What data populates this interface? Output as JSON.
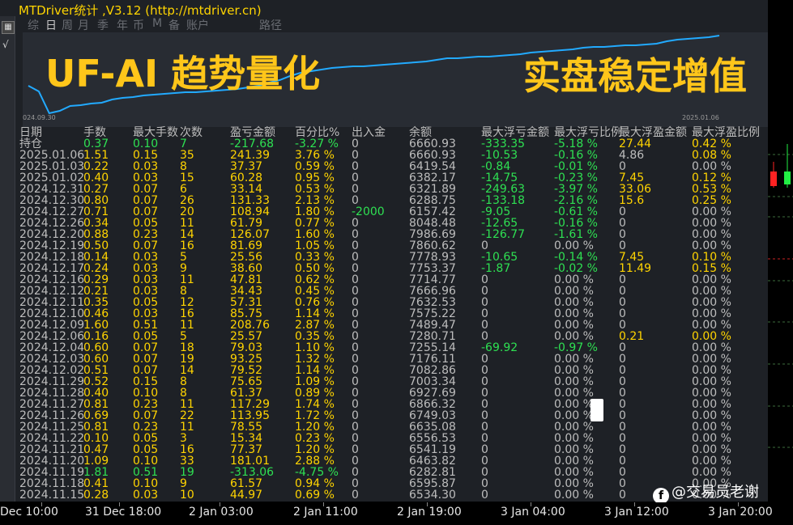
{
  "window": {
    "title": "MTDriver统计 ,V3.12 (http://mtdriver.cn)"
  },
  "sidebar": {
    "buttons": [
      {
        "name": "grid-icon",
        "glyph": "▦"
      },
      {
        "name": "close-icon",
        "glyph": "☒"
      },
      {
        "name": "sqrt-icon",
        "glyph": "√"
      }
    ]
  },
  "tabs": [
    {
      "label": "综",
      "active": false
    },
    {
      "label": "日",
      "active": true
    },
    {
      "label": "周",
      "active": false
    },
    {
      "label": "月",
      "active": false
    },
    {
      "label": "季",
      "active": false
    },
    {
      "label": "年",
      "active": false
    },
    {
      "label": "币",
      "active": false
    },
    {
      "label": "M",
      "active": false
    },
    {
      "label": "备",
      "active": false
    },
    {
      "label": "账户",
      "active": false
    },
    {
      "label": "路径",
      "active": false
    }
  ],
  "equity": {
    "overlay_left": "UF-AI 趋势量化",
    "overlay_right": "实盘稳定增值",
    "date_start": "024.09.30",
    "date_end": "2025.01.06",
    "values": [
      38,
      31,
      4,
      7,
      13,
      14,
      16,
      17,
      21,
      23,
      24,
      26,
      27,
      28,
      29,
      30,
      30,
      31,
      32,
      33,
      34,
      36,
      38,
      42,
      45,
      50,
      54,
      56,
      58,
      60,
      61,
      62,
      62,
      63,
      64,
      65,
      66,
      67,
      68,
      70,
      72,
      72,
      73,
      74,
      74,
      75,
      76,
      77,
      79,
      80,
      81,
      82,
      83,
      85,
      86,
      86,
      87,
      88,
      88,
      89,
      90,
      93,
      95,
      96,
      97,
      98,
      100
    ]
  },
  "table": {
    "headers": [
      "日期",
      "手数",
      "最大手数",
      "次数",
      "盈亏金额",
      "百分比%",
      "出入金",
      "余额",
      "最大浮亏金额",
      "最大浮亏比例",
      "最大浮盈金额",
      "最大浮盈比例"
    ],
    "rows": [
      {
        "c": [
          "持仓",
          "0.37",
          "0.10",
          "7",
          "-217.68",
          "-3.27 %",
          "0",
          "6660.93",
          "-333.35",
          "-5.18 %",
          "27.44",
          "0.42 %"
        ],
        "k": [
          "w",
          "g",
          "g",
          "g",
          "g",
          "g",
          "w",
          "w",
          "g",
          "g",
          "y",
          "y"
        ]
      },
      {
        "c": [
          "2025.01.06",
          "1.51",
          "0.15",
          "35",
          "241.39",
          "3.76 %",
          "0",
          "6660.93",
          "-10.53",
          "-0.16 %",
          "4.86",
          "0.08 %"
        ],
        "k": [
          "w",
          "y",
          "y",
          "y",
          "y",
          "y",
          "w",
          "w",
          "g",
          "g",
          "w",
          "y"
        ]
      },
      {
        "c": [
          "2025.01.03",
          "0.22",
          "0.03",
          "8",
          "37.37",
          "0.59 %",
          "0",
          "6419.54",
          "-0.84",
          "-0.01 %",
          "0",
          "0.00 %"
        ],
        "k": [
          "w",
          "y",
          "y",
          "y",
          "y",
          "y",
          "w",
          "w",
          "g",
          "g",
          "w",
          "w"
        ]
      },
      {
        "c": [
          "2025.01.02",
          "0.40",
          "0.03",
          "15",
          "60.28",
          "0.95 %",
          "0",
          "6382.17",
          "-14.75",
          "-0.23 %",
          "7.45",
          "0.12 %"
        ],
        "k": [
          "w",
          "y",
          "y",
          "y",
          "y",
          "y",
          "w",
          "w",
          "g",
          "g",
          "y",
          "y"
        ]
      },
      {
        "c": [
          "2024.12.31",
          "0.27",
          "0.07",
          "6",
          "33.14",
          "0.53 %",
          "0",
          "6321.89",
          "-249.63",
          "-3.97 %",
          "33.06",
          "0.53 %"
        ],
        "k": [
          "w",
          "y",
          "y",
          "y",
          "y",
          "y",
          "w",
          "w",
          "g",
          "g",
          "y",
          "y"
        ]
      },
      {
        "c": [
          "2024.12.30",
          "0.80",
          "0.07",
          "26",
          "131.33",
          "2.13 %",
          "0",
          "6288.75",
          "-133.18",
          "-2.16 %",
          "15.6",
          "0.25 %"
        ],
        "k": [
          "w",
          "y",
          "y",
          "y",
          "y",
          "y",
          "w",
          "w",
          "g",
          "g",
          "y",
          "y"
        ]
      },
      {
        "c": [
          "2024.12.27",
          "0.71",
          "0.07",
          "20",
          "108.94",
          "1.80 %",
          "-2000",
          "6157.42",
          "-9.05",
          "-0.61 %",
          "0",
          "0.00 %"
        ],
        "k": [
          "w",
          "y",
          "y",
          "y",
          "y",
          "y",
          "g",
          "w",
          "g",
          "g",
          "w",
          "w"
        ]
      },
      {
        "c": [
          "2024.12.26",
          "0.34",
          "0.05",
          "11",
          "61.79",
          "0.77 %",
          "0",
          "8048.48",
          "-12.65",
          "-0.16 %",
          "0",
          "0.00 %"
        ],
        "k": [
          "w",
          "y",
          "y",
          "y",
          "y",
          "y",
          "w",
          "w",
          "g",
          "g",
          "w",
          "w"
        ]
      },
      {
        "c": [
          "2024.12.20",
          "0.88",
          "0.23",
          "14",
          "126.07",
          "1.60 %",
          "0",
          "7986.69",
          "-126.77",
          "-1.61 %",
          "0",
          "0.00 %"
        ],
        "k": [
          "w",
          "y",
          "y",
          "y",
          "y",
          "y",
          "w",
          "w",
          "g",
          "g",
          "w",
          "w"
        ]
      },
      {
        "c": [
          "2024.12.19",
          "0.50",
          "0.07",
          "16",
          "81.69",
          "1.05 %",
          "0",
          "7860.62",
          "0",
          "0.00 %",
          "0",
          "0.00 %"
        ],
        "k": [
          "w",
          "y",
          "y",
          "y",
          "y",
          "y",
          "w",
          "w",
          "w",
          "w",
          "w",
          "w"
        ]
      },
      {
        "c": [
          "2024.12.18",
          "0.14",
          "0.03",
          "5",
          "25.56",
          "0.33 %",
          "0",
          "7778.93",
          "-10.65",
          "-0.14 %",
          "7.45",
          "0.10 %"
        ],
        "k": [
          "w",
          "y",
          "y",
          "y",
          "y",
          "y",
          "w",
          "w",
          "g",
          "g",
          "y",
          "y"
        ]
      },
      {
        "c": [
          "2024.12.17",
          "0.24",
          "0.03",
          "9",
          "38.60",
          "0.50 %",
          "0",
          "7753.37",
          "-1.87",
          "-0.02 %",
          "11.49",
          "0.15 %"
        ],
        "k": [
          "w",
          "y",
          "y",
          "y",
          "y",
          "y",
          "w",
          "w",
          "g",
          "g",
          "y",
          "y"
        ]
      },
      {
        "c": [
          "2024.12.16",
          "0.29",
          "0.03",
          "11",
          "47.81",
          "0.62 %",
          "0",
          "7714.77",
          "0",
          "0.00 %",
          "0",
          "0.00 %"
        ],
        "k": [
          "w",
          "y",
          "y",
          "y",
          "y",
          "y",
          "w",
          "w",
          "w",
          "w",
          "w",
          "w"
        ]
      },
      {
        "c": [
          "2024.12.12",
          "0.21",
          "0.03",
          "8",
          "34.43",
          "0.45 %",
          "0",
          "7666.96",
          "0",
          "0.00 %",
          "0",
          "0.00 %"
        ],
        "k": [
          "w",
          "y",
          "y",
          "y",
          "y",
          "y",
          "w",
          "w",
          "w",
          "w",
          "w",
          "w"
        ]
      },
      {
        "c": [
          "2024.12.11",
          "0.35",
          "0.05",
          "12",
          "57.31",
          "0.76 %",
          "0",
          "7632.53",
          "0",
          "0.00 %",
          "0",
          "0.00 %"
        ],
        "k": [
          "w",
          "y",
          "y",
          "y",
          "y",
          "y",
          "w",
          "w",
          "w",
          "w",
          "w",
          "w"
        ]
      },
      {
        "c": [
          "2024.12.10",
          "0.46",
          "0.03",
          "16",
          "85.75",
          "1.14 %",
          "0",
          "7575.22",
          "0",
          "0.00 %",
          "0",
          "0.00 %"
        ],
        "k": [
          "w",
          "y",
          "y",
          "y",
          "y",
          "y",
          "w",
          "w",
          "w",
          "w",
          "w",
          "w"
        ]
      },
      {
        "c": [
          "2024.12.09",
          "1.60",
          "0.51",
          "11",
          "208.76",
          "2.87 %",
          "0",
          "7489.47",
          "0",
          "0.00 %",
          "0",
          "0.00 %"
        ],
        "k": [
          "w",
          "y",
          "y",
          "y",
          "y",
          "y",
          "w",
          "w",
          "w",
          "w",
          "w",
          "w"
        ]
      },
      {
        "c": [
          "2024.12.06",
          "0.16",
          "0.05",
          "5",
          "25.57",
          "0.35 %",
          "0",
          "7280.71",
          "0",
          "0.00 %",
          "0.21",
          "0.00 %"
        ],
        "k": [
          "w",
          "y",
          "y",
          "y",
          "y",
          "y",
          "w",
          "w",
          "w",
          "w",
          "y",
          "y"
        ]
      },
      {
        "c": [
          "2024.12.04",
          "0.60",
          "0.07",
          "18",
          "79.03",
          "1.10 %",
          "0",
          "7255.14",
          "-69.92",
          "-0.97 %",
          "0",
          "0.00 %"
        ],
        "k": [
          "w",
          "y",
          "y",
          "y",
          "y",
          "y",
          "w",
          "w",
          "g",
          "g",
          "w",
          "w"
        ]
      },
      {
        "c": [
          "2024.12.03",
          "0.60",
          "0.07",
          "19",
          "93.25",
          "1.32 %",
          "0",
          "7176.11",
          "0",
          "0.00 %",
          "0",
          "0.00 %"
        ],
        "k": [
          "w",
          "y",
          "y",
          "y",
          "y",
          "y",
          "w",
          "w",
          "w",
          "w",
          "w",
          "w"
        ]
      },
      {
        "c": [
          "2024.12.02",
          "0.51",
          "0.07",
          "14",
          "79.52",
          "1.14 %",
          "0",
          "7082.86",
          "0",
          "0.00 %",
          "0",
          "0.00 %"
        ],
        "k": [
          "w",
          "y",
          "y",
          "y",
          "y",
          "y",
          "w",
          "w",
          "w",
          "w",
          "w",
          "w"
        ]
      },
      {
        "c": [
          "2024.11.29",
          "0.52",
          "0.15",
          "8",
          "75.65",
          "1.09 %",
          "0",
          "7003.34",
          "0",
          "0.00 %",
          "0",
          "0.00 %"
        ],
        "k": [
          "w",
          "y",
          "y",
          "y",
          "y",
          "y",
          "w",
          "w",
          "w",
          "w",
          "w",
          "w"
        ]
      },
      {
        "c": [
          "2024.11.28",
          "0.40",
          "0.10",
          "8",
          "61.37",
          "0.89 %",
          "0",
          "6927.69",
          "0",
          "0.00 %",
          "0",
          "0.00 %"
        ],
        "k": [
          "w",
          "y",
          "y",
          "y",
          "y",
          "y",
          "w",
          "w",
          "w",
          "w",
          "w",
          "w"
        ]
      },
      {
        "c": [
          "2024.11.27",
          "0.81",
          "0.23",
          "11",
          "117.29",
          "1.74 %",
          "0",
          "6866.32",
          "0",
          "0.00 %",
          "0",
          "0.00 %"
        ],
        "k": [
          "w",
          "y",
          "y",
          "y",
          "y",
          "y",
          "w",
          "w",
          "w",
          "w",
          "w",
          "w"
        ]
      },
      {
        "c": [
          "2024.11.26",
          "0.69",
          "0.07",
          "22",
          "113.95",
          "1.72 %",
          "0",
          "6749.03",
          "0",
          "0.00 %",
          "0",
          "0.00 %"
        ],
        "k": [
          "w",
          "y",
          "y",
          "y",
          "y",
          "y",
          "w",
          "w",
          "w",
          "w",
          "w",
          "w"
        ]
      },
      {
        "c": [
          "2024.11.25",
          "0.81",
          "0.23",
          "11",
          "78.55",
          "1.20 %",
          "0",
          "6635.08",
          "0",
          "0.00 %",
          "0",
          "0.00 %"
        ],
        "k": [
          "w",
          "y",
          "y",
          "y",
          "y",
          "y",
          "w",
          "w",
          "w",
          "w",
          "w",
          "w"
        ]
      },
      {
        "c": [
          "2024.11.22",
          "0.10",
          "0.05",
          "3",
          "15.34",
          "0.23 %",
          "0",
          "6556.53",
          "0",
          "0.00 %",
          "0",
          "0.00 %"
        ],
        "k": [
          "w",
          "y",
          "y",
          "y",
          "y",
          "y",
          "w",
          "w",
          "w",
          "w",
          "w",
          "w"
        ]
      },
      {
        "c": [
          "2024.11.21",
          "0.47",
          "0.05",
          "16",
          "77.37",
          "1.20 %",
          "0",
          "6541.19",
          "0",
          "0.00 %",
          "0",
          "0.00 %"
        ],
        "k": [
          "w",
          "y",
          "y",
          "y",
          "y",
          "y",
          "w",
          "w",
          "w",
          "w",
          "w",
          "w"
        ]
      },
      {
        "c": [
          "2024.11.20",
          "1.09",
          "0.10",
          "33",
          "181.01",
          "2.88 %",
          "0",
          "6463.82",
          "0",
          "0.00 %",
          "0",
          "0.00 %"
        ],
        "k": [
          "w",
          "y",
          "y",
          "y",
          "y",
          "y",
          "w",
          "w",
          "w",
          "w",
          "w",
          "w"
        ]
      },
      {
        "c": [
          "2024.11.19",
          "1.81",
          "0.51",
          "19",
          "-313.06",
          "-4.75 %",
          "0",
          "6282.81",
          "0",
          "0.00 %",
          "0",
          "0.00 %"
        ],
        "k": [
          "w",
          "g",
          "g",
          "g",
          "g",
          "g",
          "w",
          "w",
          "w",
          "w",
          "w",
          "w"
        ]
      },
      {
        "c": [
          "2024.11.18",
          "0.41",
          "0.10",
          "9",
          "61.57",
          "0.94 %",
          "0",
          "6595.87",
          "0",
          "0.00 %",
          "0",
          "0.00 %"
        ],
        "k": [
          "w",
          "y",
          "y",
          "y",
          "y",
          "y",
          "w",
          "w",
          "w",
          "w",
          "w",
          "w"
        ]
      },
      {
        "c": [
          "2024.11.15",
          "0.28",
          "0.03",
          "10",
          "44.97",
          "0.69 %",
          "0",
          "6534.30",
          "0",
          "0.00 %",
          "0",
          "0.00 %"
        ],
        "k": [
          "w",
          "y",
          "y",
          "y",
          "y",
          "y",
          "w",
          "w",
          "w",
          "w",
          "w",
          "w"
        ]
      }
    ]
  },
  "time_axis": {
    "labels": [
      "Dec 10:00",
      "31 Dec 18:00",
      "2 Jan 03:00",
      "2 Jan 11:00",
      "2 Jan 19:00",
      "3 Jan 04:00",
      "3 Jan 12:00",
      "3 Jan 20:00"
    ]
  },
  "watermark": {
    "logo": "f",
    "text": "@交易员老谢"
  },
  "colors": {
    "curve": "#22aaff",
    "yellow": "#ffd400",
    "green": "#2ee052",
    "panel": "#1e2126"
  }
}
